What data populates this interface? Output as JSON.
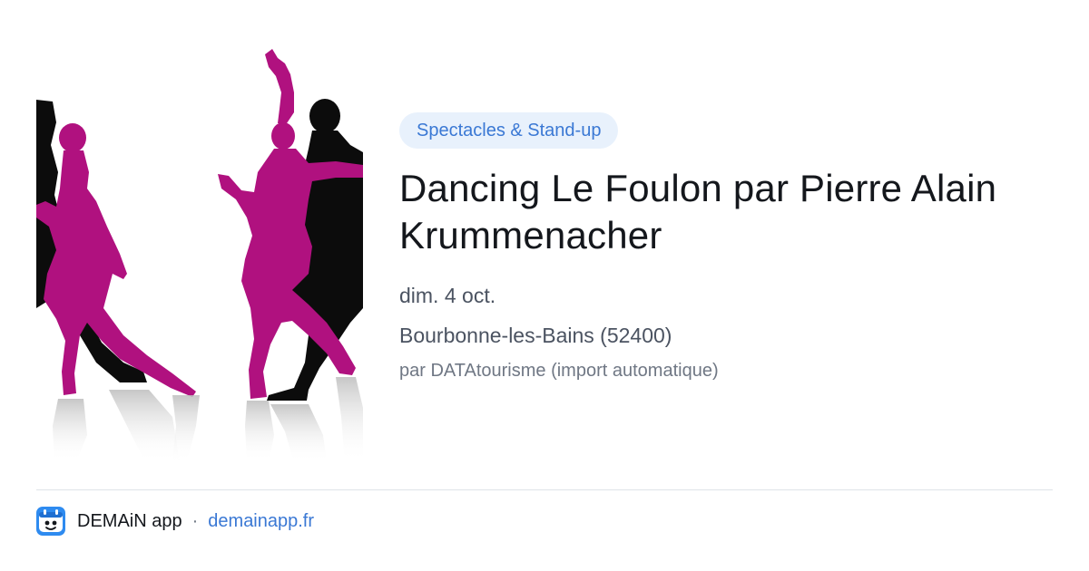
{
  "event": {
    "category": "Spectacles & Stand-up",
    "title": "Dancing Le Foulon par Pierre Alain Krummenacher",
    "date": "dim. 4 oct.",
    "location": "Bourbonne-les-Bains (52400)",
    "source": "par DATAtourisme (import automatique)"
  },
  "image": {
    "subject": "dancing-couples-silhouette",
    "colors": {
      "dress": "#b0117f",
      "partner": "#0c0c0c"
    }
  },
  "footer": {
    "app_name": "DEMAiN app",
    "separator": "·",
    "link": "demainapp.fr",
    "logo_icon": "demain-app-logo-icon"
  },
  "colors": {
    "accent": "#3a78d4",
    "pill_bg": "#e8f1fc",
    "title": "#14171c",
    "meta": "#4b5361",
    "muted": "#6f7784"
  }
}
